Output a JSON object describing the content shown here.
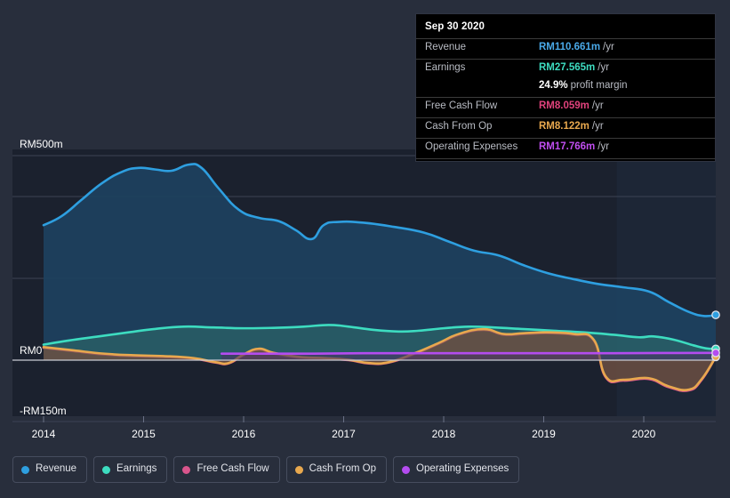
{
  "chart_data": {
    "type": "area",
    "title": "",
    "xlabel": "",
    "ylabel": "",
    "currency_prefix": "RM",
    "grid": true,
    "legend_position": "bottom-left",
    "x_ticks": [
      "2014",
      "2015",
      "2016",
      "2017",
      "2018",
      "2019",
      "2020"
    ],
    "x_tick_values": [
      2014,
      2015,
      2016,
      2017,
      2018,
      2019,
      2020
    ],
    "y_ticks": [
      "RM500m",
      "RM0",
      "-RM150m"
    ],
    "y_tick_values": [
      500,
      0,
      -150
    ],
    "ylim": [
      -150,
      560
    ],
    "xlim": [
      2014,
      2020.72
    ],
    "forecast_start": 2019.73,
    "series": [
      {
        "name": "Revenue",
        "color": "#2e9fe0",
        "fill": "#1d4160",
        "values": [
          {
            "x": 2014.0,
            "y": 330
          },
          {
            "x": 2014.18,
            "y": 352
          },
          {
            "x": 2014.38,
            "y": 392
          },
          {
            "x": 2014.58,
            "y": 432
          },
          {
            "x": 2014.78,
            "y": 460
          },
          {
            "x": 2014.95,
            "y": 470
          },
          {
            "x": 2015.12,
            "y": 466
          },
          {
            "x": 2015.28,
            "y": 463
          },
          {
            "x": 2015.45,
            "y": 478
          },
          {
            "x": 2015.58,
            "y": 470
          },
          {
            "x": 2015.75,
            "y": 420
          },
          {
            "x": 2015.95,
            "y": 368
          },
          {
            "x": 2016.15,
            "y": 348
          },
          {
            "x": 2016.35,
            "y": 340
          },
          {
            "x": 2016.52,
            "y": 318
          },
          {
            "x": 2016.68,
            "y": 296
          },
          {
            "x": 2016.8,
            "y": 330
          },
          {
            "x": 2016.95,
            "y": 338
          },
          {
            "x": 2017.2,
            "y": 336
          },
          {
            "x": 2017.5,
            "y": 326
          },
          {
            "x": 2017.8,
            "y": 312
          },
          {
            "x": 2018.05,
            "y": 290
          },
          {
            "x": 2018.3,
            "y": 268
          },
          {
            "x": 2018.55,
            "y": 256
          },
          {
            "x": 2018.8,
            "y": 232
          },
          {
            "x": 2019.05,
            "y": 212
          },
          {
            "x": 2019.3,
            "y": 198
          },
          {
            "x": 2019.55,
            "y": 186
          },
          {
            "x": 2019.8,
            "y": 178
          },
          {
            "x": 2020.05,
            "y": 168
          },
          {
            "x": 2020.25,
            "y": 142
          },
          {
            "x": 2020.45,
            "y": 118
          },
          {
            "x": 2020.6,
            "y": 108
          },
          {
            "x": 2020.72,
            "y": 110.661
          }
        ]
      },
      {
        "name": "Earnings",
        "color": "#3ddcc0",
        "fill": "#2d6a6b",
        "values": [
          {
            "x": 2014.0,
            "y": 38
          },
          {
            "x": 2014.25,
            "y": 48
          },
          {
            "x": 2014.55,
            "y": 58
          },
          {
            "x": 2014.85,
            "y": 68
          },
          {
            "x": 2015.1,
            "y": 76
          },
          {
            "x": 2015.4,
            "y": 82
          },
          {
            "x": 2015.7,
            "y": 80
          },
          {
            "x": 2016.0,
            "y": 78
          },
          {
            "x": 2016.3,
            "y": 79
          },
          {
            "x": 2016.6,
            "y": 82
          },
          {
            "x": 2016.85,
            "y": 86
          },
          {
            "x": 2017.05,
            "y": 82
          },
          {
            "x": 2017.3,
            "y": 74
          },
          {
            "x": 2017.55,
            "y": 70
          },
          {
            "x": 2017.75,
            "y": 72
          },
          {
            "x": 2018.0,
            "y": 78
          },
          {
            "x": 2018.25,
            "y": 82
          },
          {
            "x": 2018.5,
            "y": 80
          },
          {
            "x": 2018.8,
            "y": 76
          },
          {
            "x": 2019.1,
            "y": 72
          },
          {
            "x": 2019.4,
            "y": 68
          },
          {
            "x": 2019.7,
            "y": 62
          },
          {
            "x": 2019.95,
            "y": 56
          },
          {
            "x": 2020.1,
            "y": 58
          },
          {
            "x": 2020.3,
            "y": 50
          },
          {
            "x": 2020.5,
            "y": 36
          },
          {
            "x": 2020.62,
            "y": 29
          },
          {
            "x": 2020.72,
            "y": 27.565
          }
        ]
      },
      {
        "name": "Free Cash Flow",
        "color": "#d9558c",
        "fill": "#6b2f4a",
        "values": [
          {
            "x": 2014.0,
            "y": 30
          },
          {
            "x": 2014.3,
            "y": 22
          },
          {
            "x": 2014.6,
            "y": 14
          },
          {
            "x": 2014.9,
            "y": 10
          },
          {
            "x": 2015.2,
            "y": 8
          },
          {
            "x": 2015.5,
            "y": 4
          },
          {
            "x": 2015.72,
            "y": -6
          },
          {
            "x": 2015.85,
            "y": -8
          },
          {
            "x": 2016.0,
            "y": 12
          },
          {
            "x": 2016.15,
            "y": 26
          },
          {
            "x": 2016.3,
            "y": 16
          },
          {
            "x": 2016.55,
            "y": 6
          },
          {
            "x": 2016.8,
            "y": 4
          },
          {
            "x": 2017.05,
            "y": 0
          },
          {
            "x": 2017.25,
            "y": -8
          },
          {
            "x": 2017.45,
            "y": -6
          },
          {
            "x": 2017.7,
            "y": 14
          },
          {
            "x": 2017.95,
            "y": 40
          },
          {
            "x": 2018.15,
            "y": 62
          },
          {
            "x": 2018.4,
            "y": 74
          },
          {
            "x": 2018.6,
            "y": 62
          },
          {
            "x": 2018.8,
            "y": 64
          },
          {
            "x": 2019.05,
            "y": 66
          },
          {
            "x": 2019.3,
            "y": 62
          },
          {
            "x": 2019.5,
            "y": 48
          },
          {
            "x": 2019.62,
            "y": -42
          },
          {
            "x": 2019.8,
            "y": -50
          },
          {
            "x": 2020.05,
            "y": -46
          },
          {
            "x": 2020.25,
            "y": -66
          },
          {
            "x": 2020.45,
            "y": -74
          },
          {
            "x": 2020.58,
            "y": -48
          },
          {
            "x": 2020.72,
            "y": 8.059
          }
        ]
      },
      {
        "name": "Cash From Op",
        "color": "#e8a84e",
        "fill": "#6b5a3f",
        "values": [
          {
            "x": 2014.0,
            "y": 32
          },
          {
            "x": 2014.3,
            "y": 24
          },
          {
            "x": 2014.6,
            "y": 16
          },
          {
            "x": 2014.9,
            "y": 12
          },
          {
            "x": 2015.2,
            "y": 10
          },
          {
            "x": 2015.5,
            "y": 5
          },
          {
            "x": 2015.72,
            "y": -5
          },
          {
            "x": 2015.85,
            "y": -7
          },
          {
            "x": 2016.0,
            "y": 14
          },
          {
            "x": 2016.15,
            "y": 28
          },
          {
            "x": 2016.3,
            "y": 18
          },
          {
            "x": 2016.55,
            "y": 8
          },
          {
            "x": 2016.8,
            "y": 5
          },
          {
            "x": 2017.05,
            "y": 1
          },
          {
            "x": 2017.25,
            "y": -7
          },
          {
            "x": 2017.45,
            "y": -5
          },
          {
            "x": 2017.7,
            "y": 16
          },
          {
            "x": 2017.95,
            "y": 42
          },
          {
            "x": 2018.15,
            "y": 64
          },
          {
            "x": 2018.4,
            "y": 76
          },
          {
            "x": 2018.6,
            "y": 64
          },
          {
            "x": 2018.8,
            "y": 66
          },
          {
            "x": 2019.05,
            "y": 68
          },
          {
            "x": 2019.3,
            "y": 64
          },
          {
            "x": 2019.5,
            "y": 50
          },
          {
            "x": 2019.62,
            "y": -40
          },
          {
            "x": 2019.8,
            "y": -48
          },
          {
            "x": 2020.05,
            "y": -44
          },
          {
            "x": 2020.25,
            "y": -64
          },
          {
            "x": 2020.45,
            "y": -72
          },
          {
            "x": 2020.58,
            "y": -46
          },
          {
            "x": 2020.72,
            "y": 8.122
          }
        ]
      },
      {
        "name": "Operating Expenses",
        "color": "#b44cf0",
        "fill": "#4a3566",
        "values": [
          {
            "x": 2015.78,
            "y": 16
          },
          {
            "x": 2016.2,
            "y": 16
          },
          {
            "x": 2016.7,
            "y": 16
          },
          {
            "x": 2017.2,
            "y": 17
          },
          {
            "x": 2017.7,
            "y": 17
          },
          {
            "x": 2018.2,
            "y": 17
          },
          {
            "x": 2018.7,
            "y": 17
          },
          {
            "x": 2019.2,
            "y": 17
          },
          {
            "x": 2019.7,
            "y": 17
          },
          {
            "x": 2020.2,
            "y": 17.5
          },
          {
            "x": 2020.72,
            "y": 17.766
          }
        ]
      }
    ]
  },
  "tooltip": {
    "date": "Sep 30 2020",
    "rows": [
      {
        "label": "Revenue",
        "value": "RM110.661m",
        "unit": "/yr",
        "color": "#4aa9e8",
        "separator": true
      },
      {
        "label": "Earnings",
        "value": "RM27.565m",
        "unit": "/yr",
        "color": "#3ddcc0",
        "separator": true
      },
      {
        "label": "",
        "value": "24.9%",
        "unit": "profit margin",
        "color": "#ffffff",
        "separator": false
      },
      {
        "label": "Free Cash Flow",
        "value": "RM8.059m",
        "unit": "/yr",
        "color": "#e0427c",
        "separator": true
      },
      {
        "label": "Cash From Op",
        "value": "RM8.122m",
        "unit": "/yr",
        "color": "#e8a84e",
        "separator": true
      },
      {
        "label": "Operating Expenses",
        "value": "RM17.766m",
        "unit": "/yr",
        "color": "#c04ef0",
        "separator": true
      }
    ]
  },
  "legend": {
    "items": [
      {
        "label": "Revenue",
        "color": "#2e9fe0"
      },
      {
        "label": "Earnings",
        "color": "#3ddcc0"
      },
      {
        "label": "Free Cash Flow",
        "color": "#d9558c"
      },
      {
        "label": "Cash From Op",
        "color": "#e8a84e"
      },
      {
        "label": "Operating Expenses",
        "color": "#b44cf0"
      }
    ]
  },
  "colors": {
    "background": "#282e3c",
    "plot_background": "#1b212e",
    "forecast_background": "#1d2636",
    "gridline": "#3c4354",
    "zeroline": "#c9ccd4",
    "tooltip_background": "#000000"
  }
}
